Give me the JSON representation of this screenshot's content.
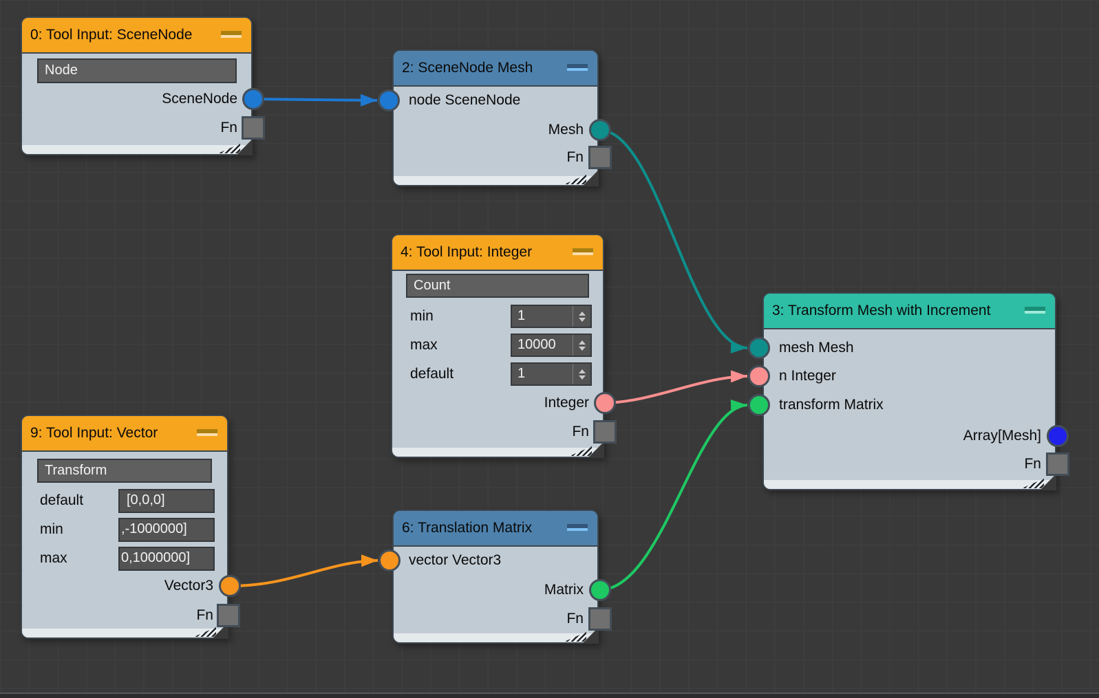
{
  "canvas": {
    "background": "#393939",
    "grid_line": "#414141",
    "bottom_edge_light": "#57595B",
    "bottom_edge_dark": "#2B2C2D"
  },
  "header_colors": {
    "tool_input_orange": "#F6A51F",
    "operator_blue": "#4E82AD",
    "operator_teal": "#2EBEA5"
  },
  "port_colors": {
    "scenenode": "#1E79D3",
    "mesh": "#0E8F8C",
    "integer": "#F98F8F",
    "vector3": "#F7941E",
    "matrix": "#1EC863",
    "array_mesh": "#2121EE",
    "fn": "#707070"
  },
  "nodes": {
    "n0": {
      "title": "0: Tool Input: SceneNode",
      "name_value": "Node",
      "out_label": "SceneNode",
      "fn_label": "Fn"
    },
    "n2": {
      "title": "2: SceneNode Mesh",
      "in_label": "node SceneNode",
      "out_label": "Mesh",
      "fn_label": "Fn"
    },
    "n4": {
      "title": "4: Tool Input: Integer",
      "name_value": "Count",
      "params": [
        {
          "label": "min",
          "value": "1"
        },
        {
          "label": "max",
          "value": "10000"
        },
        {
          "label": "default",
          "value": "1"
        }
      ],
      "out_label": "Integer",
      "fn_label": "Fn"
    },
    "n9": {
      "title": "9: Tool Input: Vector",
      "name_value": "Transform",
      "params": [
        {
          "label": "default",
          "value": "[0,0,0]"
        },
        {
          "label": "min",
          "value": ",-1000000]"
        },
        {
          "label": "max",
          "value": "0,1000000]"
        }
      ],
      "out_label": "Vector3",
      "fn_label": "Fn"
    },
    "n6": {
      "title": "6: Translation Matrix",
      "in_label": "vector Vector3",
      "out_label": "Matrix",
      "fn_label": "Fn"
    },
    "n3": {
      "title": "3: Transform Mesh with Increment",
      "in_labels": [
        "mesh Mesh",
        "n Integer",
        "transform Matrix"
      ],
      "out_label": "Array[Mesh]",
      "fn_label": "Fn"
    }
  },
  "connections": [
    {
      "from": "0: SceneNode",
      "to": "2: node",
      "color": "#1E79D3"
    },
    {
      "from": "2: Mesh",
      "to": "3: mesh",
      "color": "#0E8F8C"
    },
    {
      "from": "4: Integer",
      "to": "3: n",
      "color": "#F98F8F"
    },
    {
      "from": "9: Vector3",
      "to": "6: vector",
      "color": "#F7941E"
    },
    {
      "from": "6: Matrix",
      "to": "3: transform",
      "color": "#1EC863"
    }
  ]
}
